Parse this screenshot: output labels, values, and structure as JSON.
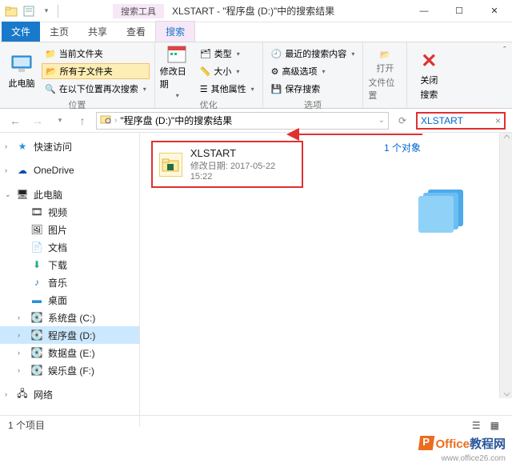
{
  "titlebar": {
    "contextual_label": "搜索工具",
    "title": "XLSTART - \"程序盘 (D:)\"中的搜索结果",
    "min": "—",
    "max": "☐",
    "close": "✕"
  },
  "tabs": {
    "file": "文件",
    "home": "主页",
    "share": "共享",
    "view": "查看",
    "search": "搜索"
  },
  "ribbon": {
    "group_location": {
      "label": "位置",
      "this_pc": "此电脑",
      "current_folder": "当前文件夹",
      "all_subfolders": "所有子文件夹",
      "search_again": "在以下位置再次搜索"
    },
    "group_refine": {
      "label": "优化",
      "date": "修改日期",
      "kind": "类型",
      "size": "大小",
      "other": "其他属性"
    },
    "group_options": {
      "label": "选项",
      "recent": "最近的搜索内容",
      "advanced": "高级选项",
      "save": "保存搜索"
    },
    "open_loc": {
      "label1": "打开",
      "label2": "文件位置"
    },
    "close_search": {
      "label1": "关闭",
      "label2": "搜索"
    }
  },
  "addressbar": {
    "path": "\"程序盘 (D:)\"中的搜索结果",
    "search_value": "XLSTART",
    "clear": "×"
  },
  "sidebar": {
    "quick_access": "快速访问",
    "onedrive": "OneDrive",
    "this_pc": "此电脑",
    "items": [
      "视频",
      "图片",
      "文档",
      "下载",
      "音乐",
      "桌面",
      "系统盘 (C:)",
      "程序盘 (D:)",
      "数据盘 (E:)",
      "娱乐盘 (F:)"
    ],
    "network": "网络"
  },
  "result": {
    "name": "XLSTART",
    "meta_label": "修改日期:",
    "meta_value": "2017-05-22 15:22"
  },
  "preview": {
    "header": "1 个对象"
  },
  "statusbar": {
    "text": "1 个项目"
  },
  "watermark": {
    "text": "Office教程网",
    "url": "www.office26.com"
  }
}
